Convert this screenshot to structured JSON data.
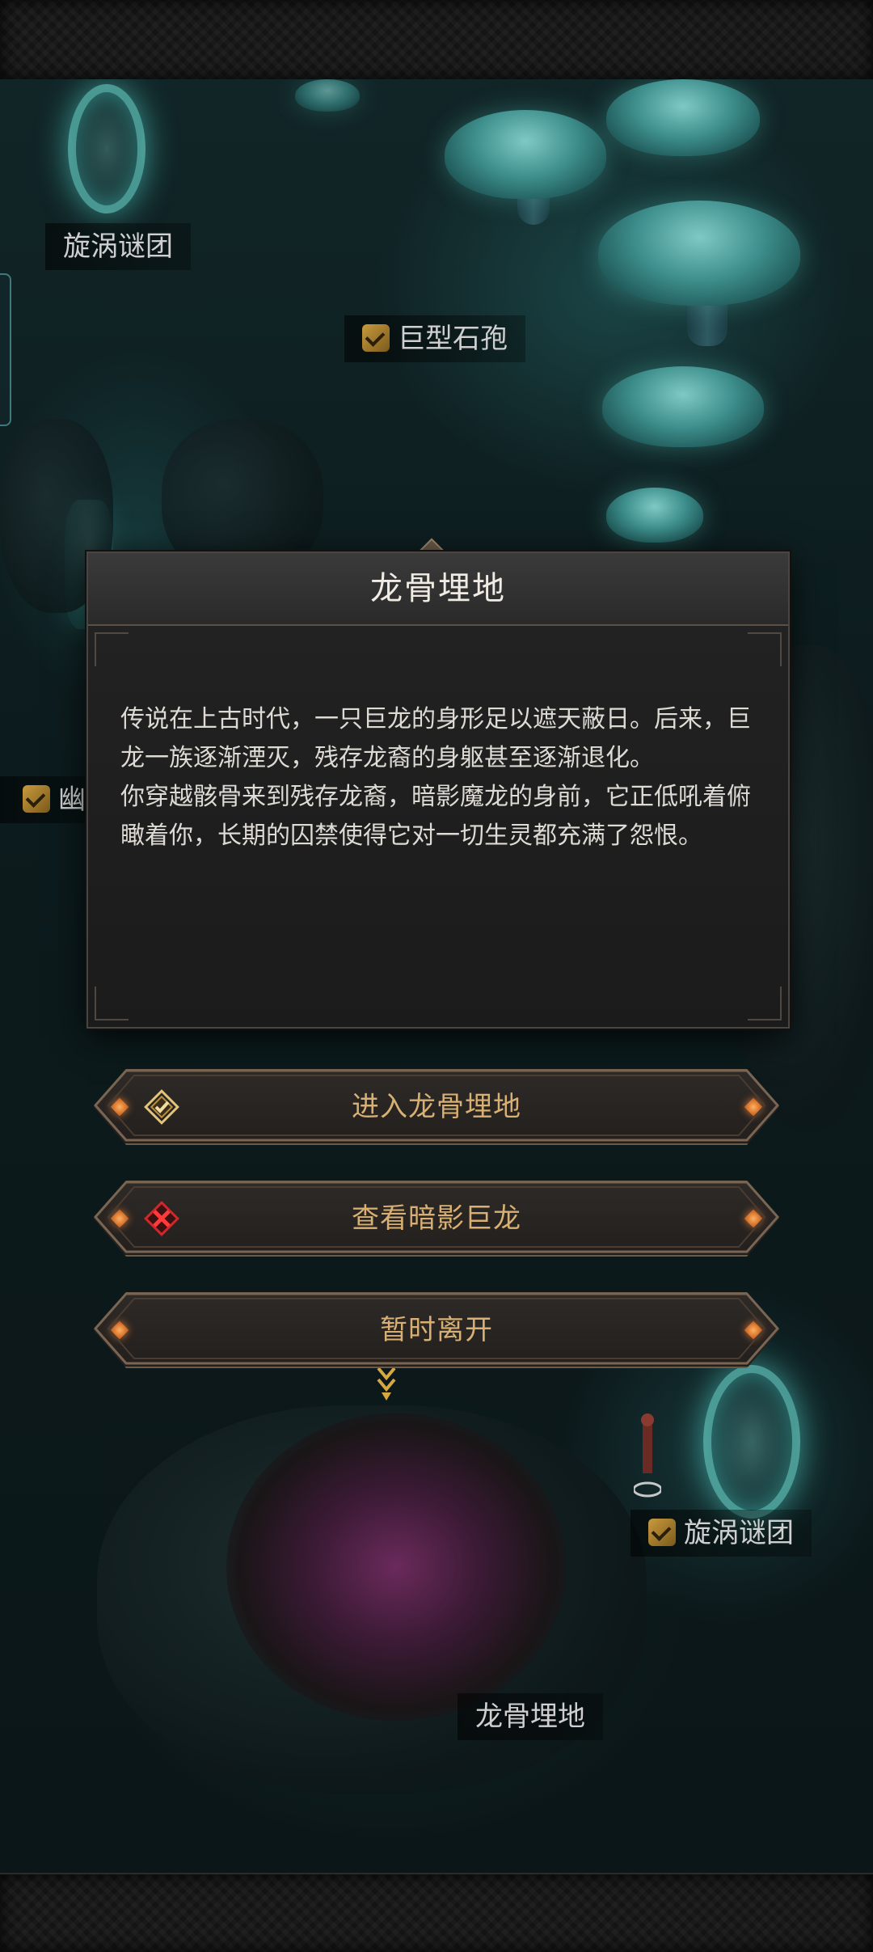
{
  "map": {
    "labels": [
      {
        "id": "vortex-top",
        "text": "旋涡谜团",
        "checked": false
      },
      {
        "id": "giant-spore",
        "text": "巨型石孢",
        "checked": true
      },
      {
        "id": "partial-left",
        "text": "幽",
        "checked": true
      },
      {
        "id": "vortex-bottom",
        "text": "旋涡谜团",
        "checked": true
      },
      {
        "id": "dragon-bone",
        "text": "龙骨埋地",
        "checked": false
      }
    ]
  },
  "dialog": {
    "title": "龙骨埋地",
    "paragraph_1": "传说在上古时代，一只巨龙的身形足以遮天蔽日。后来，巨龙一族逐渐湮灭，残存龙裔的身躯甚至逐渐退化。",
    "paragraph_2": "你穿越骸骨来到残存龙裔，暗影魔龙的身前，它正低吼着俯瞰着你，长期的囚禁使得它对一切生灵都充满了怨恨。"
  },
  "options": [
    {
      "label": "进入龙骨埋地",
      "icon": "gold-check-diamond-icon"
    },
    {
      "label": "查看暗影巨龙",
      "icon": "red-cross-diamond-icon"
    },
    {
      "label": "暂时离开",
      "icon": ""
    }
  ],
  "colors": {
    "accent_gold": "#d8b073",
    "glow_cyan": "#78f0e6",
    "gem_orange": "#ff9a4a",
    "cross_red": "#d0282a"
  }
}
